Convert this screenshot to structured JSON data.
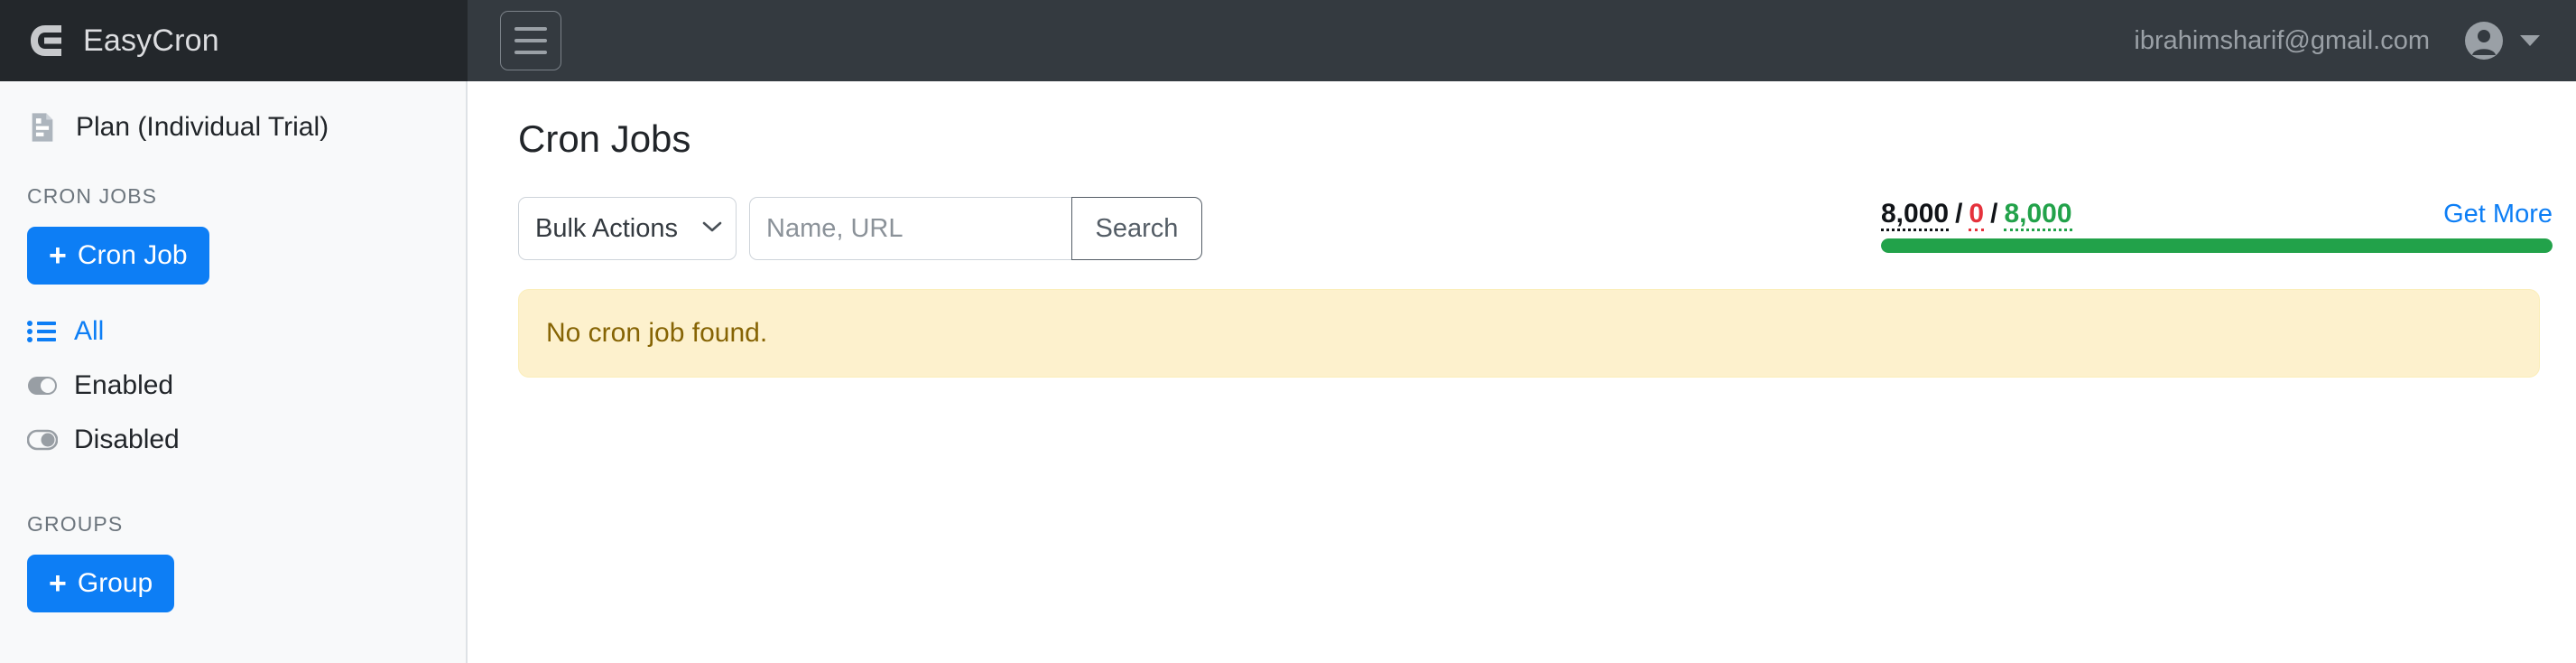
{
  "header": {
    "brand_name": "EasyCron",
    "brand_logo_icon": "easycron-c-logo",
    "menu_toggle_icon": "hamburger-icon",
    "user_email": "ibrahimsharif@gmail.com",
    "avatar_icon": "user-circle-icon",
    "caret_icon": "caret-down-icon"
  },
  "sidebar": {
    "plan": {
      "label": "Plan (Individual Trial)",
      "icon": "file-invoice-icon"
    },
    "cron_jobs_section": {
      "title": "CRON JOBS",
      "add_button": {
        "plus": "+",
        "label": "Cron Job"
      },
      "items": [
        {
          "label": "All",
          "icon": "list-ul-icon",
          "state": "active"
        },
        {
          "label": "Enabled",
          "icon": "toggle-on-icon",
          "state": "plain"
        },
        {
          "label": "Disabled",
          "icon": "toggle-off-icon",
          "state": "plain"
        }
      ]
    },
    "groups_section": {
      "title": "GROUPS",
      "add_button": {
        "plus": "+",
        "label": "Group"
      }
    }
  },
  "main": {
    "page_title": "Cron Jobs",
    "toolbar": {
      "bulk_action": {
        "selected": "Bulk Actions",
        "chevron_icon": "chevron-down-icon"
      },
      "search_placeholder": "Name, URL",
      "search_value": "",
      "search_button": "Search"
    },
    "quota": {
      "total": "8,000",
      "used": "0",
      "remaining": "8,000",
      "separator": "/",
      "get_more": "Get More",
      "bar_percent": 100,
      "colors": {
        "total": "#111418",
        "used": "#e5323c",
        "remaining": "#22a24a",
        "bar": "#22a24a"
      }
    },
    "alert": {
      "message": "No cron job found.",
      "background": "#fdf1cd",
      "text_color": "#866404"
    }
  }
}
